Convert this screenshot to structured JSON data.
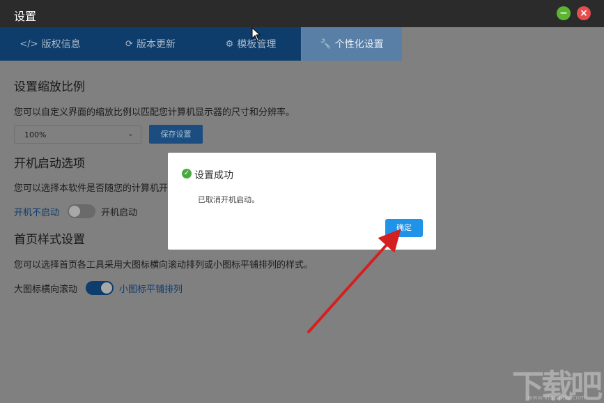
{
  "window": {
    "title": "设置",
    "minimize_icon": "minimize-icon",
    "close_icon": "close-icon",
    "minimize_glyph": "−",
    "close_glyph": "×"
  },
  "tabs": [
    {
      "icon": "code-icon",
      "glyph": "</>",
      "label": "版权信息",
      "active": false
    },
    {
      "icon": "refresh-icon",
      "glyph": "⟳",
      "label": "版本更新",
      "active": false
    },
    {
      "icon": "gear-icon",
      "glyph": "⚙",
      "label": "模板管理",
      "active": false
    },
    {
      "icon": "wrench-icon",
      "glyph": "🔧",
      "label": "个性化设置",
      "active": true
    }
  ],
  "scale": {
    "heading": "设置缩放比例",
    "description": "您可以自定义界面的缩放比例以匹配您计算机显示器的尺寸和分辨率。",
    "select_value": "100%",
    "save_label": "保存设置"
  },
  "startup": {
    "heading": "开机启动选项",
    "description": "您可以选择本软件是否随您的计算机开",
    "off_label": "开机不启动",
    "on_label": "开机启动",
    "enabled": false
  },
  "homepage": {
    "heading": "首页样式设置",
    "description": "您可以选择首页各工具采用大图标横向滚动排列或小图标平铺排列的样式。",
    "big_label": "大图标横向滚动",
    "small_label": "小图标平铺排列",
    "small_selected": true
  },
  "dialog": {
    "title": "设置成功",
    "message": "已取消开机启动。",
    "ok_label": "确定",
    "icon": "check-circle-icon",
    "check_glyph": "✓"
  },
  "watermark": {
    "text": "下载吧",
    "url": "www.xiazaiba.com"
  },
  "colors": {
    "titlebar": "#2b2b2b",
    "tab_active": "#5a7fa6",
    "tab_inactive": "#0e3d6b",
    "ok_button": "#1e93e8",
    "annotation_arrow": "#d42020"
  }
}
